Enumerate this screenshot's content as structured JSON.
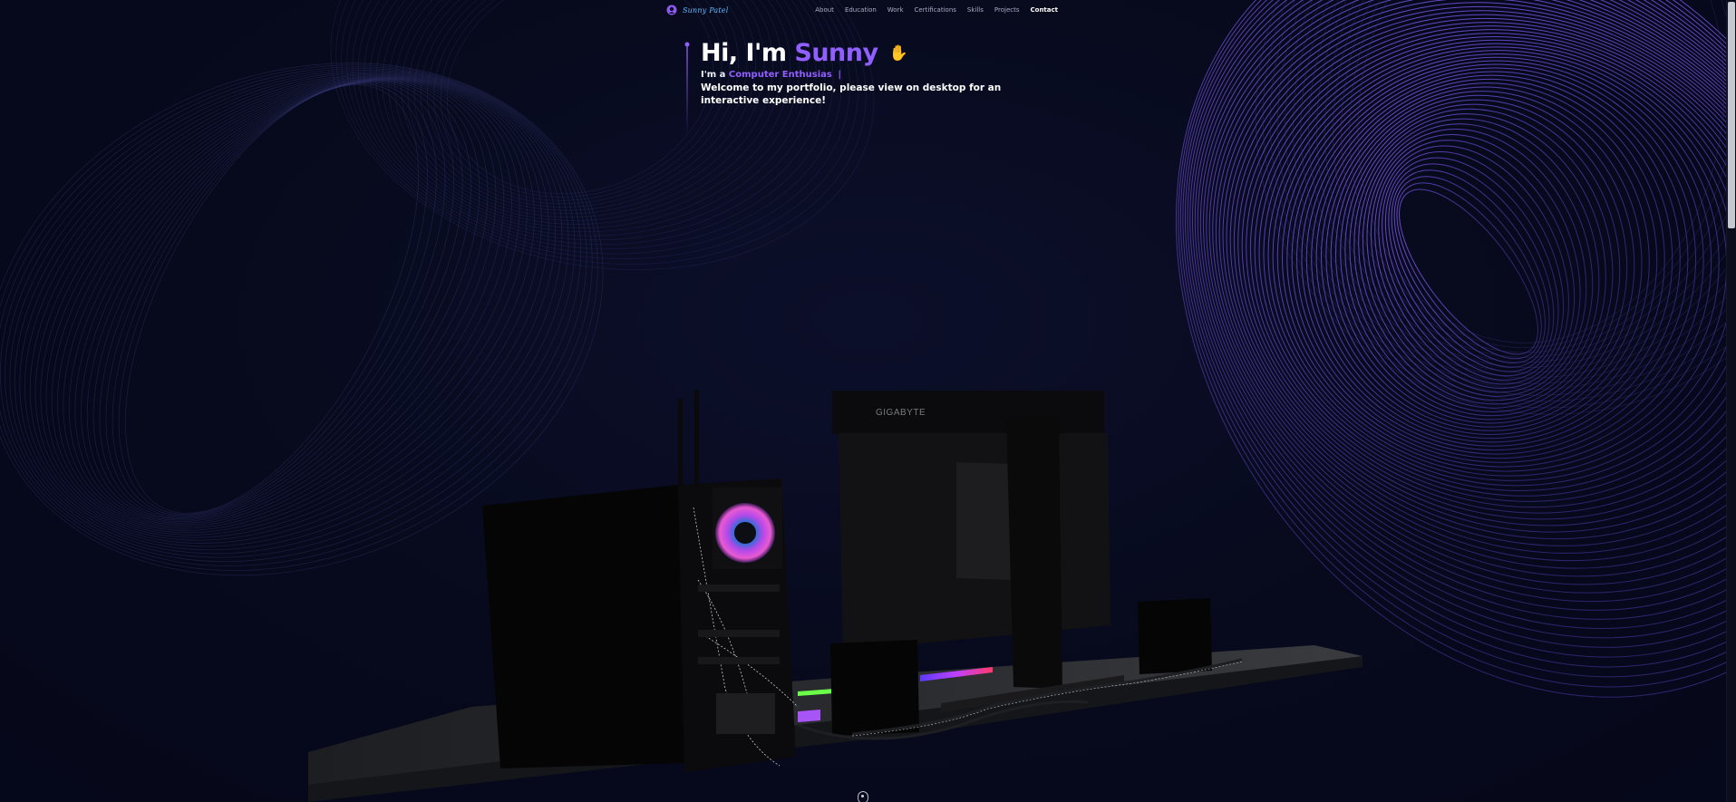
{
  "logo": {
    "text": "Sunny Patel",
    "icon": "logo-icon"
  },
  "nav": {
    "items": [
      {
        "label": "About"
      },
      {
        "label": "Education"
      },
      {
        "label": "Work"
      },
      {
        "label": "Certifications"
      },
      {
        "label": "Skills"
      },
      {
        "label": "Projects"
      },
      {
        "label": "Contact"
      }
    ],
    "active": "Contact"
  },
  "hero": {
    "greeting": "Hi, I'm",
    "name": "Sunny",
    "wave_icon": "waving-hand-icon",
    "role_prefix": "I'm a",
    "role": "Computer Enthusias",
    "caret": "|",
    "description": "Welcome to my portfolio, please view on desktop for an interactive experience!"
  },
  "scene": {
    "monitor_brand": "GIGABYTE"
  },
  "colors": {
    "accent": "#915eff",
    "background": "#060818",
    "logo": "#5fb8ff",
    "wave_lines": "#6b4fd8"
  }
}
